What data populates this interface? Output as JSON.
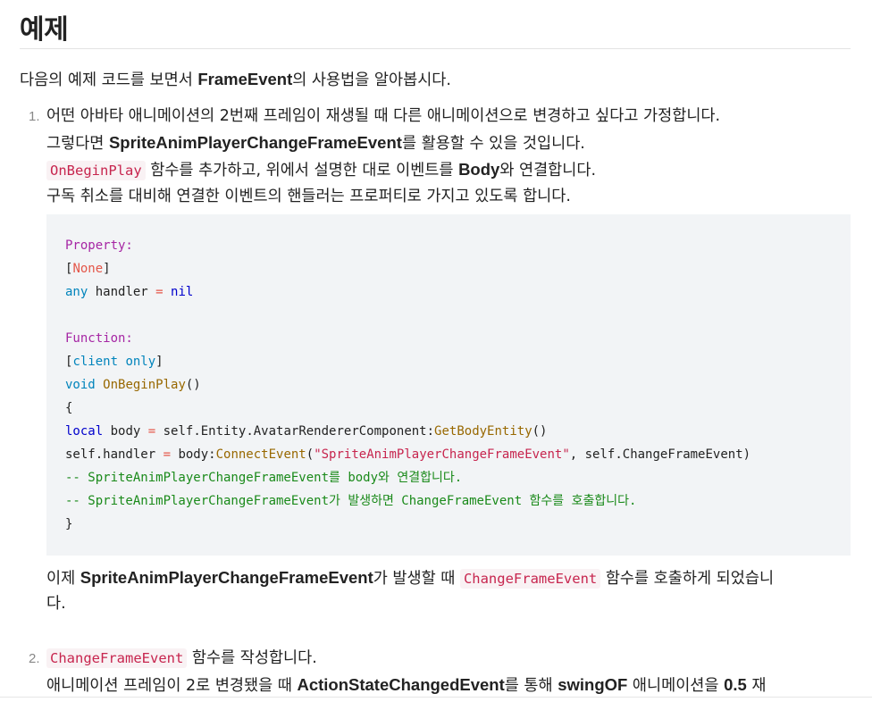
{
  "heading": "예제",
  "intro": {
    "pre": "다음의 예제 코드를 보면서 ",
    "bold": "FrameEvent",
    "post": "의 사용법을 알아봅시다."
  },
  "item1": {
    "num": "1.",
    "line1": "어떤 아바타 애니메이션의 2번째 프레임이 재생될 때 다른 애니메이션으로 변경하고 싶다고 가정합니다.",
    "line2": {
      "pre": "그렇다면 ",
      "bold": "SpriteAnimPlayerChangeFrameEvent",
      "post": "를 활용할 수 있을 것입니다."
    },
    "line3": {
      "code": "OnBeginPlay",
      "mid": " 함수를 추가하고, 위에서 설명한 대로 이벤트를 ",
      "bold": "Body",
      "post": "와 연결합니다."
    },
    "line4": "구독 취소를 대비해 연결한 이벤트의 핸들러는 프로퍼티로 가지고 있도록 합니다.",
    "code": {
      "l1": "Property:",
      "l2_open": "[",
      "l2_kw": "None",
      "l2_close": "]",
      "l3_type": "any",
      "l3_mid": " handler ",
      "l3_eq": "=",
      "l3_val": "nil",
      "l5": "Function:",
      "l6_open": "[",
      "l6_kw": "client only",
      "l6_close": "]",
      "l7_kw": "void",
      "l7_fn": "OnBeginPlay",
      "l7_rest": "()",
      "l8": "{",
      "l9_kw": "local",
      "l9_mid": " body ",
      "l9_eq": "=",
      "l9_obj": " self.Entity.AvatarRendererComponent:",
      "l9_fn": "GetBodyEntity",
      "l9_rest": "()",
      "l10_pre": "self.handler ",
      "l10_eq": "=",
      "l10_obj": " body:",
      "l10_fn": "ConnectEvent",
      "l10_open": "(",
      "l10_str": "\"SpriteAnimPlayerChangeFrameEvent\"",
      "l10_rest": ", self.ChangeFrameEvent)",
      "l11": "-- SpriteAnimPlayerChangeFrameEvent를 body와 연결합니다.",
      "l12": "-- SpriteAnimPlayerChangeFrameEvent가 발생하면 ChangeFrameEvent 함수를 호출합니다.",
      "l13": "}"
    },
    "after1": {
      "pre": "이제 ",
      "bold": "SpriteAnimPlayerChangeFrameEvent",
      "mid": "가 발생할 때 ",
      "code": "ChangeFrameEvent",
      "post": " 함수를 호출하게 되었습니"
    },
    "after2": "다."
  },
  "item2": {
    "num": "2.",
    "line1": {
      "code": "ChangeFrameEvent",
      "post": " 함수를 작성합니다."
    },
    "line2": {
      "pre": "애니메이션 프레임이 2로 변경됐을 때 ",
      "bold1": "ActionStateChangedEvent",
      "mid": "를 통해 ",
      "bold2": "swingOF",
      "mid2": " 애니메이션을 ",
      "bold3": "0.5",
      "post": " 재"
    }
  }
}
